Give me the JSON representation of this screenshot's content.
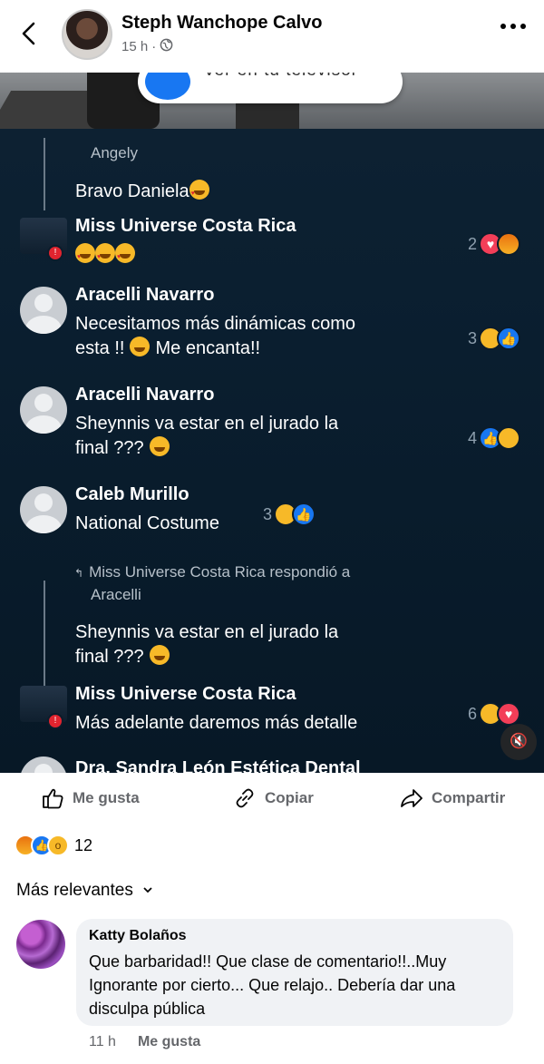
{
  "header": {
    "author_name": "Steph Wanchope Calvo",
    "time": "15 h",
    "separator": "·",
    "icons": [
      "back-arrow-icon",
      "globe-icon",
      "more-icon"
    ]
  },
  "video": {
    "cast_prompt": "ver en tu televisor",
    "comments": [
      {
        "name": "Angely",
        "text": "Bravo Daniela"
      },
      {
        "name": "Miss Universe Costa Rica",
        "text": "",
        "reaction_count": "2"
      },
      {
        "name": "Aracelli Navarro",
        "text_line1": "Necesitamos más dinámicas como",
        "text_line2": "esta !!",
        "text_line2_end": "Me encanta!!",
        "reaction_count": "3"
      },
      {
        "name": "Aracelli Navarro",
        "text_line1": "Sheynnis va estar en el jurado la",
        "text_line2": "final ???",
        "reaction_count": "4"
      },
      {
        "name": "Caleb Murillo",
        "text": "National Costume",
        "reaction_count": "3"
      },
      {
        "reply_header_line1": "Miss Universe Costa Rica respondió a",
        "reply_header_line2": "Aracelli",
        "quoted_line1": "Sheynnis va estar en el jurado la",
        "quoted_line2": "final ???"
      },
      {
        "name": "Miss Universe Costa Rica",
        "text": "Más adelante daremos más detalle",
        "reaction_count": "6"
      },
      {
        "name": "Dra. Sandra León Estética Dental"
      }
    ],
    "mute_icon": "volume-off-icon"
  },
  "actions": {
    "like_label": "Me gusta",
    "copy_label": "Copiar",
    "share_label": "Compartir"
  },
  "reactions": {
    "count": "12",
    "types": [
      "angry",
      "like",
      "wow"
    ]
  },
  "sort": {
    "label": "Más relevantes"
  },
  "comment": {
    "name": "Katty Bolaños",
    "text": "Que barbaridad!! Que clase de comentario!!..Muy Ignorante por cierto... Que relajo.. Debería dar una disculpa pública",
    "time": "11 h",
    "like_label": "Me gusta"
  },
  "colors": {
    "facebook_blue": "#1877f2",
    "secondary_text": "#65676b",
    "bubble_bg": "#f0f2f5"
  }
}
